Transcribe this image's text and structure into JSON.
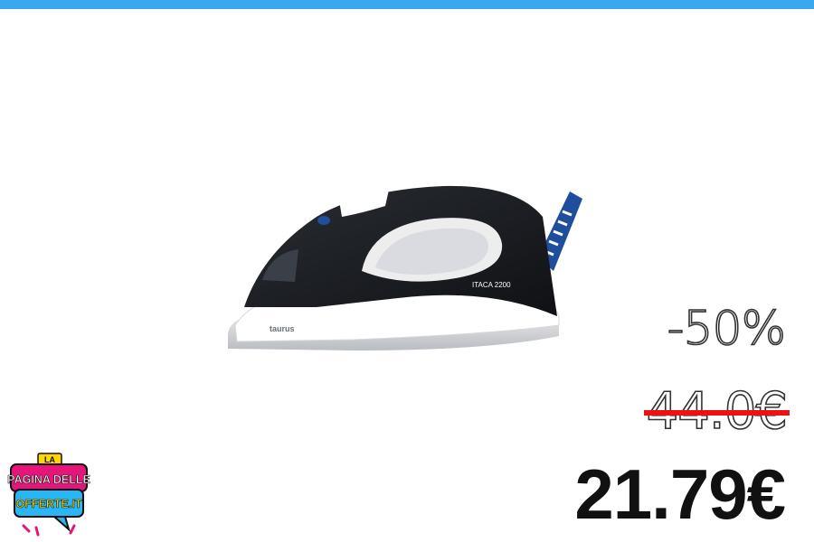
{
  "colors": {
    "top_bar": "#3aa8f0",
    "strike": "#ee1111",
    "price": "#111111",
    "logo_pink": "#e6157a",
    "logo_cyan": "#29b6f6",
    "logo_yellow": "#ffd600",
    "iron_accent": "#1f4e9c"
  },
  "product": {
    "brand": "taurus",
    "model": "ITACA 2200",
    "icon": "steam-iron-image"
  },
  "offer": {
    "discount": "-50%",
    "old_price": "44.0€",
    "price": "21.79€"
  },
  "logo": {
    "line1": "LA",
    "line2": "PAGINA DELLE",
    "line3": "OFFERTE.IT"
  }
}
